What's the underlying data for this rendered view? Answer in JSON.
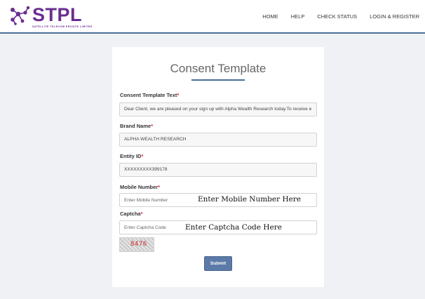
{
  "brand": {
    "name": "STPL",
    "tagline": "SATELLITE TELECOM PRIVATE LIMITED",
    "color": "#6a2d91"
  },
  "nav": {
    "items": [
      "HOME",
      "HELP",
      "CHECK STATUS",
      "LOGIN & REGISTER"
    ]
  },
  "form": {
    "title": "Consent Template",
    "required_marker": "*",
    "fields": {
      "template_text": {
        "label": "Consent Template Text",
        "value": "Dear Client, we are pleased on your sign up with Alpha Wealth Research today.To receive e"
      },
      "brand_name": {
        "label": "Brand Name",
        "value": "ALPHA WEALTH RESEARCH"
      },
      "entity_id": {
        "label": "Entity ID",
        "value": "XXXXXXXXX399178"
      },
      "mobile": {
        "label": "Mobile Number",
        "placeholder": "Enter Mobile Number",
        "note": "Enter Mobile Number Here"
      },
      "captcha": {
        "label": "Captcha",
        "placeholder": "Enter Captcha Code",
        "note": "Enter Captcha Code Here",
        "image_text": "8476"
      }
    },
    "submit_label": "Submit"
  },
  "colors": {
    "accent": "#4a6f98",
    "button": "#5c7aa8",
    "required": "#d9232d",
    "background": "#f0f1f4"
  }
}
